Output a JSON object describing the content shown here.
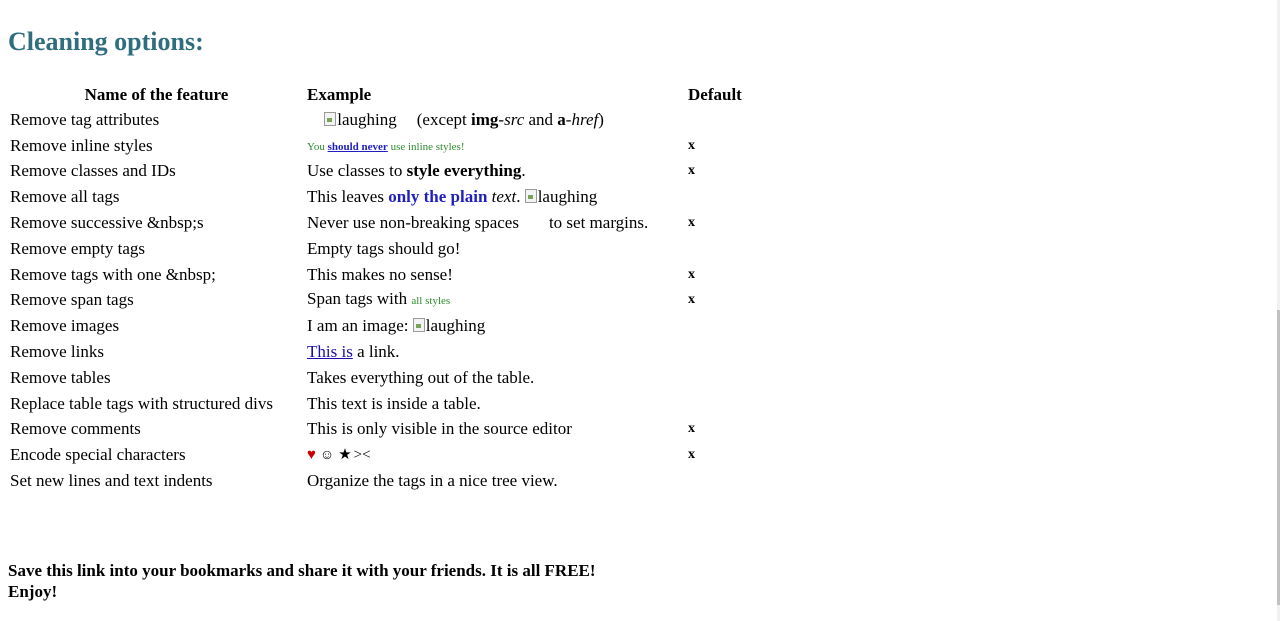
{
  "title": "Cleaning options:",
  "table": {
    "headers": {
      "name": "Name of the feature",
      "example": "Example",
      "default": "Default"
    },
    "rows": [
      {
        "name": "Remove tag attributes",
        "default": ""
      },
      {
        "name": "Remove inline styles",
        "default": "x"
      },
      {
        "name": "Remove classes and IDs",
        "default": "x"
      },
      {
        "name": "Remove all tags",
        "default": ""
      },
      {
        "name": "Remove successive &nbsp;s",
        "default": "x"
      },
      {
        "name": "Remove empty tags",
        "default": ""
      },
      {
        "name": "Remove tags with one &nbsp;",
        "default": "x"
      },
      {
        "name": "Remove span tags",
        "default": "x"
      },
      {
        "name": "Remove images",
        "default": ""
      },
      {
        "name": "Remove links",
        "default": ""
      },
      {
        "name": "Remove tables",
        "default": ""
      },
      {
        "name": "Replace table tags with structured divs",
        "default": ""
      },
      {
        "name": "Remove comments",
        "default": "x"
      },
      {
        "name": "Encode special characters",
        "default": "x"
      },
      {
        "name": "Set new lines and text indents",
        "default": ""
      }
    ],
    "examples": {
      "tag_attributes": {
        "img_alt": "laughing",
        "text1": "(except ",
        "bold1": "img",
        "dash1": "-",
        "italic1": "src",
        "text2": " and ",
        "bold2": "a",
        "dash2": "-",
        "italic2": "href",
        "text3": ")"
      },
      "inline_styles": {
        "text1": "You ",
        "link": "should never",
        "text2": " use inline styles!"
      },
      "classes": {
        "text1": "Use classes to ",
        "bold": "style everything",
        "text2": "."
      },
      "all_tags": {
        "text1": "This leaves ",
        "blue_bold": "only the plain",
        "italic": "text",
        "text2": ". ",
        "img_alt": "laughing"
      },
      "nbsp": {
        "text1": "Never use non-breaking spaces",
        "text2": "to set margins."
      },
      "empty_tags": "Empty tags should go!",
      "one_nbsp": "This makes no sense!",
      "span_tags": {
        "text1": "Span tags with ",
        "small": "all styles"
      },
      "images": {
        "text1": "I am an image: ",
        "img_alt": "laughing"
      },
      "links": {
        "link": "This is",
        "text": " a link."
      },
      "tables": "Takes everything out of the table.",
      "structured_divs": "This text is inside a table.",
      "comments": "This is only visible in the source editor",
      "special": {
        "heart": "♥",
        "smile": "☺",
        "star": "★",
        "gtlt": "><"
      },
      "indents": "Organize the tags in a nice tree view."
    }
  },
  "footer": {
    "line1": "Save this link into your bookmarks and share it with your friends. It is all FREE!",
    "line2": "Enjoy!"
  }
}
